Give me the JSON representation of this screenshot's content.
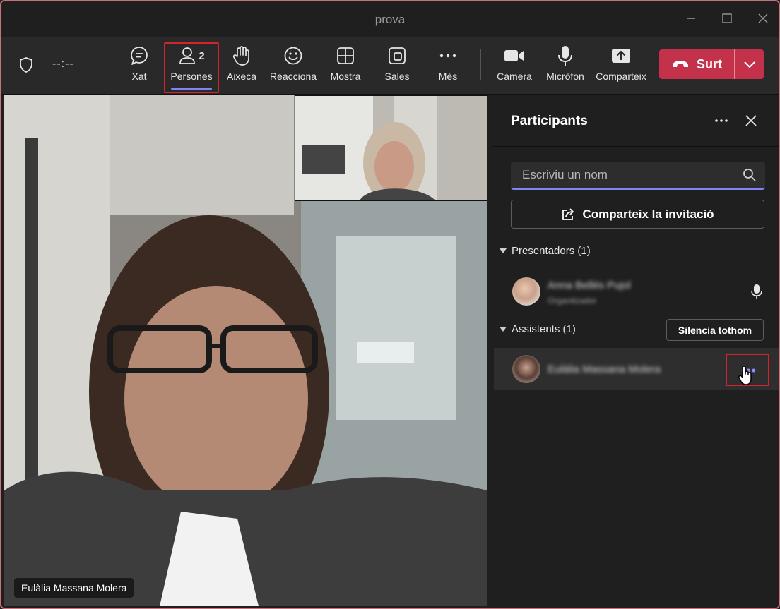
{
  "window": {
    "title": "prova"
  },
  "toolbar": {
    "timer": "--:--",
    "buttons": [
      {
        "label": "Xat",
        "icon": "chat-icon"
      },
      {
        "label": "Persones",
        "icon": "people-icon",
        "count": "2"
      },
      {
        "label": "Aixeca",
        "icon": "raise-hand-icon"
      },
      {
        "label": "Reacciona",
        "icon": "smile-icon"
      },
      {
        "label": "Mostra",
        "icon": "view-grid-icon"
      },
      {
        "label": "Sales",
        "icon": "rooms-icon"
      },
      {
        "label": "Més",
        "icon": "more-icon"
      },
      {
        "label": "Càmera",
        "icon": "camera-icon"
      },
      {
        "label": "Micròfon",
        "icon": "mic-icon"
      },
      {
        "label": "Comparteix",
        "icon": "share-icon"
      }
    ],
    "leave_label": "Surt"
  },
  "stage": {
    "main_name": "Eulàlia Massana Molera"
  },
  "panel": {
    "title": "Participants",
    "search_placeholder": "Escriviu un nom",
    "invite_label": "Comparteix la invitació",
    "presenters_header": "Presentadors (1)",
    "presenters": [
      {
        "name": "Anna Bellés Pujol",
        "role": "Organitzador"
      }
    ],
    "attendees_header": "Assistents (1)",
    "mute_all_label": "Silencia tothom",
    "attendees": [
      {
        "name": "Eulàlia Massana Molera"
      }
    ]
  },
  "colors": {
    "accent": "#7f85f5",
    "leave": "#c4314b",
    "highlight_border": "#d1242b"
  }
}
